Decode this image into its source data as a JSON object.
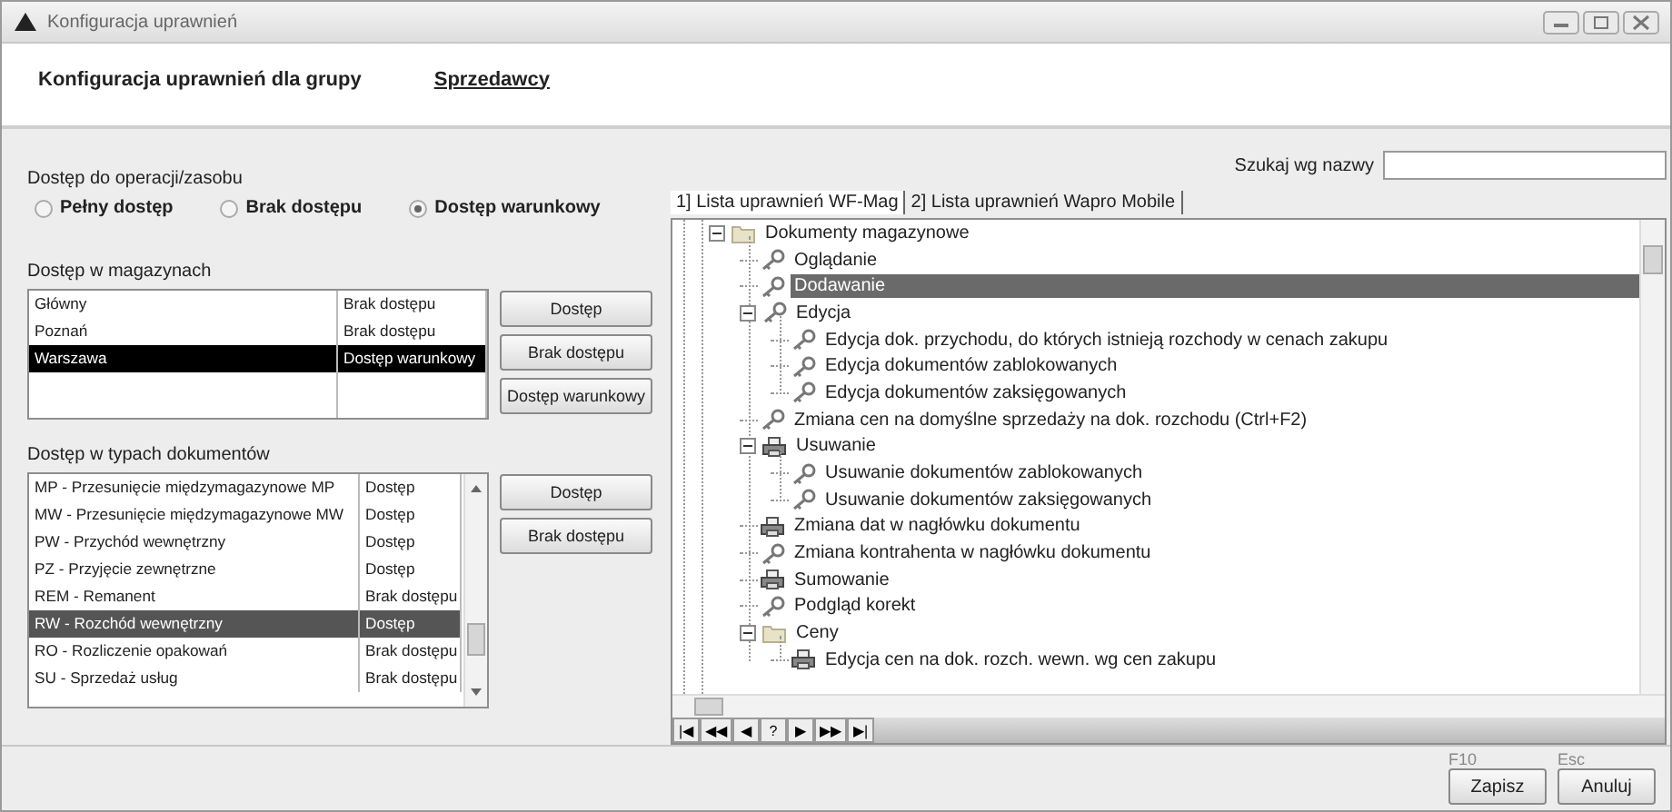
{
  "window": {
    "title": "Konfiguracja uprawnień"
  },
  "header": {
    "label": "Konfiguracja uprawnień dla grupy",
    "group": "Sprzedawcy"
  },
  "access": {
    "label": "Dostęp do operacji/zasobu",
    "options": [
      {
        "label": "Pełny dostęp",
        "selected": false
      },
      {
        "label": "Brak dostępu",
        "selected": false
      },
      {
        "label": "Dostęp warunkowy",
        "selected": true
      }
    ]
  },
  "warehouses": {
    "label": "Dostęp w magazynach",
    "rows": [
      {
        "name": "Główny",
        "access": "Brak dostępu",
        "selected": false
      },
      {
        "name": "Poznań",
        "access": "Brak dostępu",
        "selected": false
      },
      {
        "name": "Warszawa",
        "access": "Dostęp warunkowy",
        "selected": true
      }
    ],
    "buttons": [
      "Dostęp",
      "Brak dostępu",
      "Dostęp warunkowy"
    ]
  },
  "document_types": {
    "label": "Dostęp w typach dokumentów",
    "rows": [
      {
        "name": "MP - Przesunięcie międzymagazynowe MP",
        "access": "Dostęp",
        "selected": false
      },
      {
        "name": "MW - Przesunięcie międzymagazynowe MW",
        "access": "Dostęp",
        "selected": false
      },
      {
        "name": "PW - Przychód wewnętrzny",
        "access": "Dostęp",
        "selected": false
      },
      {
        "name": "PZ - Przyjęcie zewnętrzne",
        "access": "Dostęp",
        "selected": false
      },
      {
        "name": "REM - Remanent",
        "access": "Brak dostępu",
        "selected": false
      },
      {
        "name": "RW - Rozchód wewnętrzny",
        "access": "Dostęp",
        "selected": true
      },
      {
        "name": "RO - Rozliczenie opakowań",
        "access": "Brak dostępu",
        "selected": false
      },
      {
        "name": "SU - Sprzedaż usług",
        "access": "Brak dostępu",
        "selected": false
      }
    ],
    "buttons": [
      "Dostęp",
      "Brak dostępu"
    ]
  },
  "search": {
    "label": "Szukaj wg nazwy"
  },
  "tabs": [
    {
      "label": "1] Lista uprawnień WF-Mag",
      "selected": true
    },
    {
      "label": "2] Lista uprawnień Wapro Mobile",
      "selected": false
    }
  ],
  "tree": [
    {
      "label": "Dokumenty magazynowe",
      "kind": "folder",
      "expanded": true,
      "selected": false,
      "children": [
        {
          "label": "Oglądanie",
          "kind": "key",
          "selected": false
        },
        {
          "label": "Dodawanie",
          "kind": "key",
          "selected": true
        },
        {
          "label": "Edycja",
          "kind": "key",
          "expanded": true,
          "selected": false,
          "children": [
            {
              "label": "Edycja dok. przychodu, do których istnieją rozchody w cenach zakupu",
              "kind": "key",
              "selected": false
            },
            {
              "label": "Edycja dokumentów zablokowanych",
              "kind": "key",
              "selected": false
            },
            {
              "label": "Edycja dokumentów zaksięgowanych",
              "kind": "key",
              "selected": false
            }
          ]
        },
        {
          "label": "Zmiana cen na domyślne sprzedaży na dok. rozchodu (Ctrl+F2)",
          "kind": "key",
          "selected": false
        },
        {
          "label": "Usuwanie",
          "kind": "printer",
          "expanded": true,
          "selected": false,
          "children": [
            {
              "label": "Usuwanie dokumentów zablokowanych",
              "kind": "key",
              "selected": false
            },
            {
              "label": "Usuwanie dokumentów zaksięgowanych",
              "kind": "key",
              "selected": false
            }
          ]
        },
        {
          "label": "Zmiana dat w nagłówku dokumentu",
          "kind": "printer",
          "selected": false
        },
        {
          "label": "Zmiana kontrahenta w nagłówku dokumentu",
          "kind": "key",
          "selected": false
        },
        {
          "label": "Sumowanie",
          "kind": "printer",
          "selected": false
        },
        {
          "label": "Podgląd korekt",
          "kind": "key",
          "selected": false
        },
        {
          "label": "Ceny",
          "kind": "folder",
          "expanded": true,
          "selected": false,
          "children": [
            {
              "label": "Edycja cen na dok. rozch. wewn. wg cen zakupu",
              "kind": "printer",
              "selected": false
            }
          ]
        }
      ]
    }
  ],
  "navigator": [
    "|◀",
    "◀◀",
    "◀",
    "?",
    "▶",
    "▶▶",
    "▶|"
  ],
  "footer": {
    "buttons": [
      {
        "shortcut": "F10",
        "label": "Zapisz"
      },
      {
        "shortcut": "Esc",
        "label": "Anuluj"
      }
    ]
  }
}
